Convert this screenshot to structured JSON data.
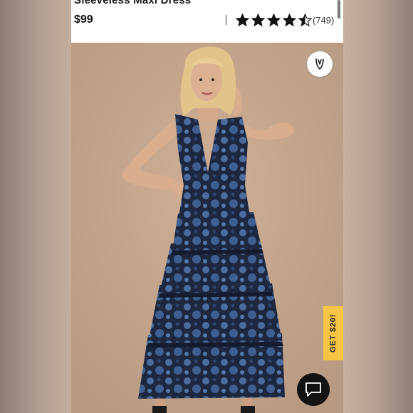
{
  "product": {
    "title": "Sleeveless Maxi Dress",
    "price": "$99",
    "rating": 4.5,
    "rating_max": 5,
    "review_count": "(749)"
  },
  "icons": {
    "star": "star-icon",
    "wishlist": "heart-icon",
    "chat": "chat-bubble-icon"
  },
  "promo": {
    "label": "GET $20!"
  },
  "colors": {
    "promo_bg": "#f6c543",
    "chat_bg": "#121212",
    "photo_bg": "#c6a68b",
    "dress_navy": "#1d2740",
    "dress_blue": "#4b6c9c"
  }
}
